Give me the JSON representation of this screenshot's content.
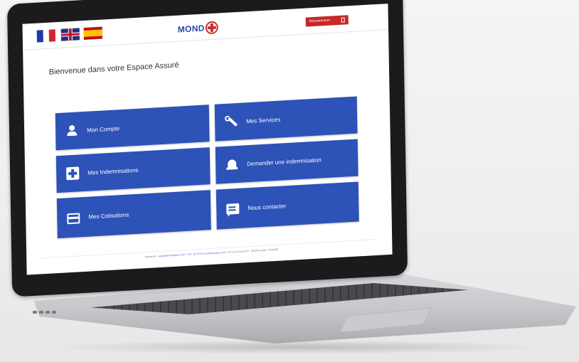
{
  "header": {
    "languages": [
      {
        "name": "french-flag-icon",
        "colors": [
          "#1f3aa6",
          "#ffffff",
          "#d6252f"
        ]
      },
      {
        "name": "uk-flag-icon"
      },
      {
        "name": "spanish-flag-icon"
      }
    ],
    "logo_text": "MOND",
    "logout_label": "Déconnexion"
  },
  "main": {
    "welcome": "Bienvenue dans votre Espace Assuré",
    "tiles": [
      {
        "label": "Mon Compte",
        "icon": "user-icon"
      },
      {
        "label": "Mes Services",
        "icon": "wrench-icon"
      },
      {
        "label": "Mes Indemnisations",
        "icon": "medkit-icon"
      },
      {
        "label": "Demander une indemnisation",
        "icon": "bell-icon"
      },
      {
        "label": "Mes Cotisations",
        "icon": "card-icon"
      },
      {
        "label": "Nous contacter",
        "icon": "chat-icon"
      }
    ]
  },
  "footer": {
    "prefix": "Assistance :",
    "link": "assure@mondassur.com / +33 · 01 23 45 mondassurance.com",
    "suffix": "/ 70 rue du Long Prix · 69100 Europe · FRANCE"
  },
  "colors": {
    "tile_blue": "#2d52b8",
    "logout_red": "#c62828",
    "logo_blue": "#2b45a8"
  }
}
